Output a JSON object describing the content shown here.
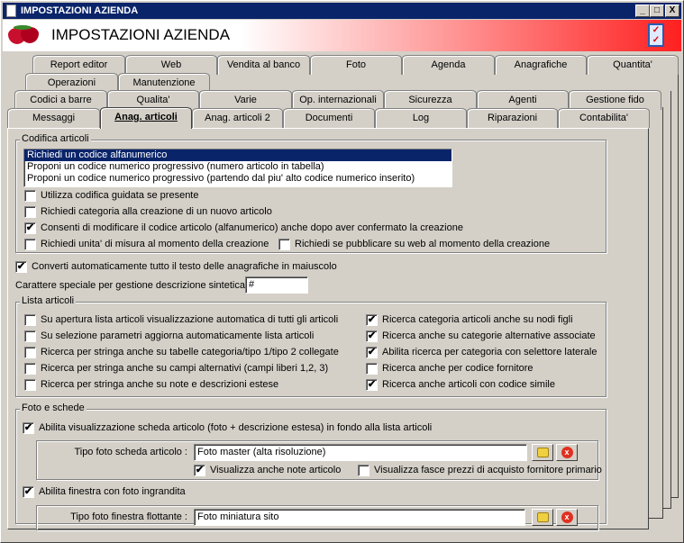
{
  "window": {
    "title": "IMPOSTAZIONI AZIENDA",
    "minimize": "_",
    "maximize": "□",
    "close": "X"
  },
  "header": {
    "title": "IMPOSTAZIONI AZIENDA",
    "logo_icon": "strawberry-icon",
    "right_icon": "checklist-icon"
  },
  "tabs": {
    "row1": [
      "Report editor",
      "Web",
      "Vendita al banco",
      "Foto",
      "Agenda",
      "Anagrafiche",
      "Quantita'"
    ],
    "row2": [
      "Operazioni",
      "Manutenzione"
    ],
    "row3": [
      "Codici a barre",
      "Qualita'",
      "Varie",
      "Op. internazionali",
      "Sicurezza",
      "Agenti",
      "Gestione fido"
    ],
    "row4": [
      "Messaggi",
      "Anag. articoli",
      "Anag. articoli 2",
      "Documenti",
      "Log",
      "Riparazioni",
      "Contabilita'"
    ],
    "active": "Anag. articoli"
  },
  "codifica": {
    "title": "Codifica articoli",
    "options": [
      "Richiedi un codice alfanumerico",
      "Proponi un codice numerico progressivo (numero articolo in tabella)",
      "Proponi un codice numerico progressivo (partendo dal piu' alto codice numerico inserito)"
    ],
    "selected": 0,
    "checks": [
      {
        "label": "Utilizza codifica guidata se presente",
        "checked": false
      },
      {
        "label": "Richiedi categoria alla creazione di un nuovo articolo",
        "checked": false
      },
      {
        "label": "Consenti di modificare il codice articolo (alfanumerico) anche dopo aver confermato la creazione",
        "checked": true
      },
      {
        "label": "Richiedi unita' di misura al momento della creazione",
        "checked": false
      },
      {
        "label": "Richiedi se pubblicare su web al momento della creazione",
        "checked": false
      }
    ]
  },
  "maiuscolo": {
    "label": "Converti automaticamente tutto il testo delle anagrafiche in maiuscolo",
    "checked": true
  },
  "carattere": {
    "label": "Carattere speciale per gestione descrizione sintetica :",
    "value": "#"
  },
  "lista": {
    "title": "Lista articoli",
    "left": [
      {
        "label": "Su apertura lista articoli visualizzazione automatica di tutti gli articoli",
        "checked": false
      },
      {
        "label": "Su selezione parametri aggiorna automaticamente lista articoli",
        "checked": false
      },
      {
        "label": "Ricerca per stringa anche su tabelle categoria/tipo 1/tipo 2 collegate",
        "checked": false
      },
      {
        "label": "Ricerca per stringa anche su campi alternativi (campi liberi 1,2, 3)",
        "checked": false
      },
      {
        "label": "Ricerca per stringa anche su note e descrizioni estese",
        "checked": false
      }
    ],
    "right": [
      {
        "label": "Ricerca categoria articoli anche su nodi figli",
        "checked": true
      },
      {
        "label": "Ricerca anche su categorie alternative associate",
        "checked": true
      },
      {
        "label": "Abilita ricerca per categoria con selettore laterale",
        "checked": true
      },
      {
        "label": "Ricerca anche per codice fornitore",
        "checked": false
      },
      {
        "label": "Ricerca anche articoli con codice simile",
        "checked": true
      }
    ]
  },
  "foto": {
    "title": "Foto e schede",
    "scheda": {
      "label": "Abilita visualizzazione scheda articolo (foto + descrizione estesa) in fondo alla lista articoli",
      "checked": true
    },
    "tipo_scheda": {
      "label": "Tipo foto scheda articolo :",
      "value": "Foto master (alta risoluzione)"
    },
    "note": {
      "label": "Visualizza anche note articolo",
      "checked": true
    },
    "fasce": {
      "label": "Visualizza fasce prezzi di acquisto fornitore primario",
      "checked": false
    },
    "finestra": {
      "label": "Abilita finestra con foto ingrandita",
      "checked": true
    },
    "tipo_finestra": {
      "label": "Tipo foto finestra flottante :",
      "value": "Foto miniatura sito"
    },
    "browse_icon": "folder-icon",
    "clear_icon": "delete-icon"
  },
  "check_mark": "✔"
}
